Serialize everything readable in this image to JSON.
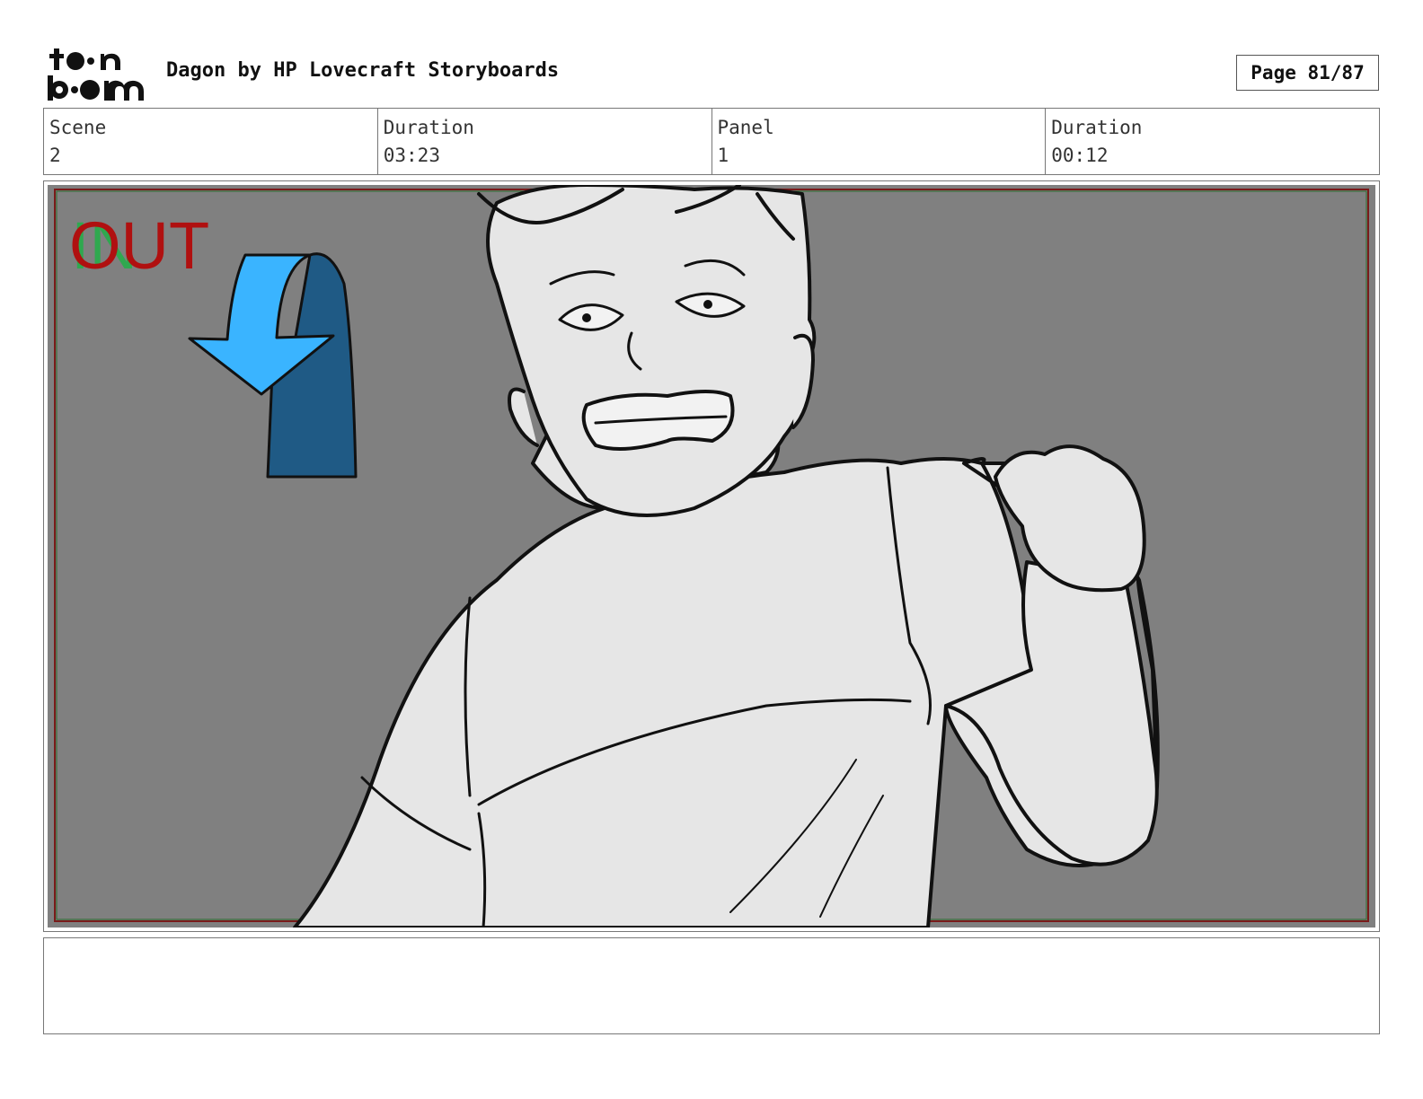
{
  "header": {
    "logo_text": "toon boom",
    "title": "Dagon by HP Lovecraft Storyboards",
    "page_label": "Page 81/87"
  },
  "info": {
    "scene_label": "Scene",
    "scene_value": "2",
    "scene_duration_label": "Duration",
    "scene_duration_value": "03:23",
    "panel_label": "Panel",
    "panel_value": "1",
    "panel_duration_label": "Duration",
    "panel_duration_value": "00:12"
  },
  "panel": {
    "transition_in_label": "IN",
    "transition_out_label": "OUT",
    "background_color": "#808080",
    "arrow_color": "#3ab4ff",
    "arrow_shadow_color": "#1f5a85"
  },
  "notes": {
    "text": ""
  }
}
